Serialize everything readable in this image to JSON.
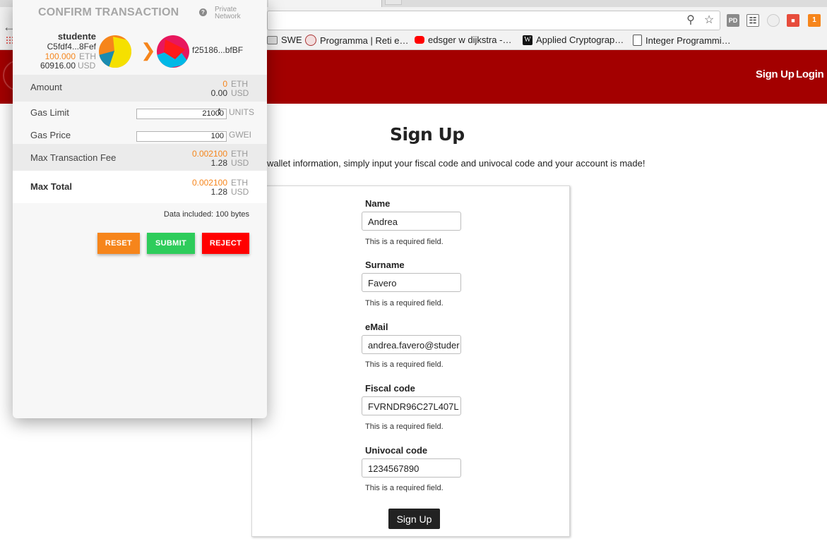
{
  "browser": {
    "bookmarks": [
      {
        "label": "SWE",
        "icon": "folder-icon"
      },
      {
        "label": "Programma | Reti e…",
        "icon": "unipd-icon"
      },
      {
        "label": "edsger w dijkstra -…",
        "icon": "youtube-icon"
      },
      {
        "label": "Applied Cryptograp…",
        "icon": "wikipedia-icon"
      },
      {
        "label": "Integer Programmi…",
        "icon": "page-icon"
      }
    ],
    "extensions": [
      "PD"
    ]
  },
  "site": {
    "nav": {
      "signup": "Sign Up",
      "login": "Login"
    },
    "title": "Sign Up",
    "intro": "wallet information, simply input your fiscal code and univocal code and your account is made!",
    "form": {
      "fields": [
        {
          "label": "Name",
          "value": "Andrea",
          "help": "This is a required field."
        },
        {
          "label": "Surname",
          "value": "Favero",
          "help": "This is a required field."
        },
        {
          "label": "eMail",
          "value": "andrea.favero@studer",
          "help": "This is a required field."
        },
        {
          "label": "Fiscal code",
          "value": "FVRNDR96C27L407L",
          "help": "This is a required field."
        },
        {
          "label": "Univocal code",
          "value": "1234567890",
          "help": "This is a required field."
        }
      ],
      "submit": "Sign Up"
    }
  },
  "metamask": {
    "title": "CONFIRM TRANSACTION",
    "network": {
      "line1": "Private",
      "line2": "Network"
    },
    "from": {
      "name": "studente",
      "address": "C5fdf4...8Fef",
      "eth_balance": "100.000",
      "eth_unit": "ETH",
      "usd_balance": "60916.00",
      "usd_unit": "USD"
    },
    "to": {
      "address": "f25186...bfBF"
    },
    "amount": {
      "label": "Amount",
      "eth": "0",
      "eth_unit": "ETH",
      "usd": "0.00",
      "usd_unit": "USD"
    },
    "gas_limit": {
      "label": "Gas Limit",
      "value": "21000",
      "unit": "UNITS"
    },
    "gas_price": {
      "label": "Gas Price",
      "value": "100",
      "unit": "GWEI"
    },
    "max_fee": {
      "label": "Max Transaction Fee",
      "eth": "0.002100",
      "eth_unit": "ETH",
      "usd": "1.28",
      "usd_unit": "USD"
    },
    "max_total": {
      "label": "Max Total",
      "eth": "0.002100",
      "eth_unit": "ETH",
      "usd": "1.28",
      "usd_unit": "USD"
    },
    "data_included": "Data included: 100 bytes",
    "buttons": {
      "reset": "RESET",
      "submit": "SUBMIT",
      "reject": "REJECT"
    },
    "colors": {
      "accent": "#f6851b",
      "reset": "#f6851b",
      "submit": "#2ecc5b",
      "reject": "#ff0000"
    }
  }
}
